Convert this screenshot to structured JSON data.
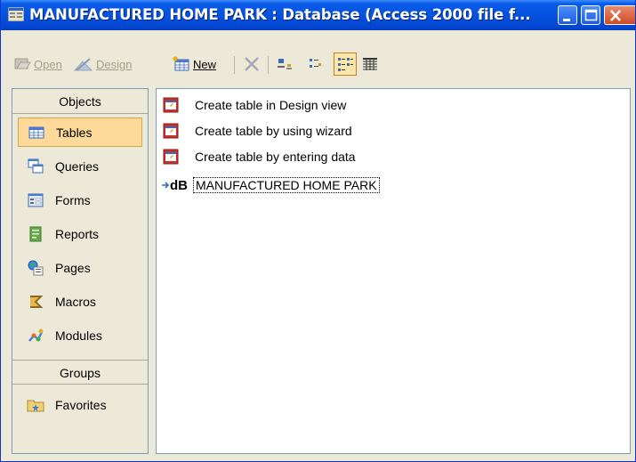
{
  "window": {
    "title": "MANUFACTURED HOME PARK : Database (Access 2000 file f...",
    "controls": [
      "minimize-icon",
      "maximize-icon",
      "close-icon"
    ]
  },
  "toolbar": {
    "open_label": "Open",
    "design_label": "Design",
    "new_label": "New"
  },
  "objects_bar": {
    "objects_header": "Objects",
    "items": [
      {
        "label": "Tables",
        "icon": "table-icon",
        "selected": true
      },
      {
        "label": "Queries",
        "icon": "query-icon"
      },
      {
        "label": "Forms",
        "icon": "form-icon"
      },
      {
        "label": "Reports",
        "icon": "report-icon"
      },
      {
        "label": "Pages",
        "icon": "page-icon"
      },
      {
        "label": "Macros",
        "icon": "macro-icon"
      },
      {
        "label": "Modules",
        "icon": "module-icon"
      }
    ],
    "groups_header": "Groups",
    "groups": [
      {
        "label": "Favorites",
        "icon": "favorites-folder-icon"
      }
    ]
  },
  "list": {
    "items": [
      {
        "label": "Create table in Design view",
        "icon": "wizard-icon"
      },
      {
        "label": "Create table by using wizard",
        "icon": "wizard-icon"
      },
      {
        "label": "Create table by entering data",
        "icon": "wizard-icon"
      },
      {
        "label": "MANUFACTURED HOME PARK",
        "icon": "linked-table-icon",
        "prefix": "dB"
      }
    ]
  },
  "colors": {
    "titlebar": "#0552e0",
    "selected_item": "#fdd99a",
    "chrome": "#ece9d8"
  }
}
